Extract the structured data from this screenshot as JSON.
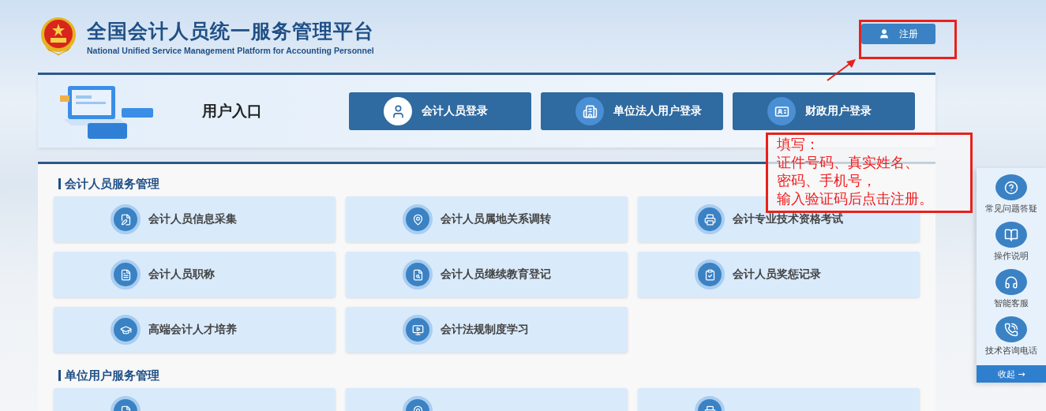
{
  "header": {
    "title": "全国会计人员统一服务管理平台",
    "subtitle": "National Unified Service Management Platform for Accounting Personnel",
    "register_button": "注册"
  },
  "entry": {
    "title": "用户入口",
    "buttons": [
      {
        "label": "会计人员登录",
        "kind": "person"
      },
      {
        "label": "单位法人用户登录",
        "kind": "building"
      },
      {
        "label": "财政用户登录",
        "kind": "badge"
      }
    ]
  },
  "sections": [
    {
      "title": "会计人员服务管理",
      "items": [
        {
          "label": "会计人员信息采集",
          "kind": "full"
        },
        {
          "label": "会计人员属地关系调转",
          "kind": "full"
        },
        {
          "label": "会计专业技术资格考试",
          "kind": "full"
        },
        {
          "label": "会计人员职称",
          "kind": "full"
        },
        {
          "label": "会计人员继续教育登记",
          "kind": "full"
        },
        {
          "label": "会计人员奖惩记录",
          "kind": "full"
        },
        {
          "label": "高端会计人才培养",
          "kind": "full"
        },
        {
          "label": "会计法规制度学习",
          "kind": "full"
        }
      ]
    },
    {
      "title": "单位用户服务管理",
      "items": [
        {
          "kind": "cut"
        },
        {
          "kind": "cut"
        },
        {
          "kind": "cut"
        }
      ]
    }
  ],
  "side_panel": {
    "items": [
      "常见问题答疑",
      "操作说明",
      "智能客服",
      "技术咨询电话"
    ],
    "collapse": "收起 →"
  },
  "annotation": {
    "lines": [
      "填写：",
      "证件号码、真实姓名、",
      "密码、手机号，",
      "输入验证码后点击注册。"
    ]
  }
}
